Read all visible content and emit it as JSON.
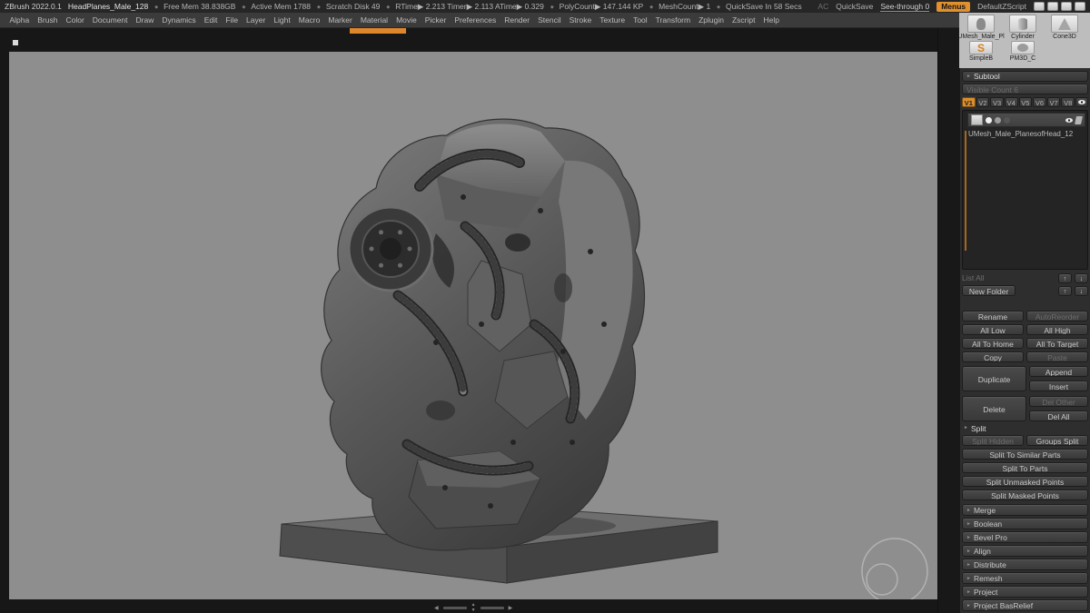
{
  "titlebar": {
    "app_name": "ZBrush 2022.0.1",
    "doc_name": "HeadPlanes_Male_128",
    "stats": [
      "Free Mem 38.838GB",
      "Active Mem 1788",
      "Scratch Disk 49",
      "RTime▶ 2.213 Timer▶ 2.113 ATime▶ 0.329",
      "PolyCount▶ 147.144 KP",
      "MeshCount▶ 1",
      "QuickSave In 58 Secs"
    ],
    "ac": "AC",
    "quicksave": "QuickSave",
    "see_through": "See-through 0",
    "menus": "Menus",
    "default_zscript": "DefaultZScript"
  },
  "menubar": {
    "items": [
      "Alpha",
      "Brush",
      "Color",
      "Document",
      "Draw",
      "Dynamics",
      "Edit",
      "File",
      "Layer",
      "Light",
      "Macro",
      "Marker",
      "Material",
      "Movie",
      "Picker",
      "Preferences",
      "Render",
      "Stencil",
      "Stroke",
      "Texture",
      "Tool",
      "Transform",
      "Zplugin",
      "Zscript",
      "Help"
    ]
  },
  "toolshelf": {
    "items": [
      {
        "label": "UMesh_Male_Pl"
      },
      {
        "label": "Cylinder"
      },
      {
        "label": "Cone3D"
      },
      {
        "label": "SimpleB"
      },
      {
        "label": "PM3D_C"
      }
    ]
  },
  "subtool": {
    "header": "Subtool",
    "visible_count": "Visible Count 6",
    "tabs": [
      "V1",
      "V2",
      "V3",
      "V4",
      "V5",
      "V6",
      "V7",
      "V8"
    ],
    "item_label": "UMesh_Male_PlanesofHead_12",
    "list_all": "List All",
    "new_folder": "New Folder",
    "rename": "Rename",
    "auto_reorder": "AutoReorder",
    "all_low": "All Low",
    "all_high": "All High",
    "all_to_home": "All To Home",
    "all_to_target": "All To Target",
    "copy": "Copy",
    "paste": "Paste",
    "duplicate": "Duplicate",
    "append": "Append",
    "insert": "Insert",
    "delete": "Delete",
    "del_other": "Del Other",
    "del_all": "Del All",
    "split_section": "Split",
    "split_hidden": "Split Hidden",
    "groups_split": "Groups Split",
    "split_similar": "Split To Similar Parts",
    "split_parts": "Split To Parts",
    "split_unmasked": "Split Unmasked Points",
    "split_masked": "Split Masked Points",
    "merge": "Merge",
    "boolean": "Boolean",
    "bevel_pro": "Bevel Pro",
    "align": "Align",
    "distribute": "Distribute",
    "remesh": "Remesh",
    "project": "Project",
    "project_basrelief": "Project BasRelief"
  },
  "icons": {
    "section_arrow": "►",
    "up": "↑",
    "down": "↓",
    "left": "◀",
    "right": "▶",
    "small_up": "▲",
    "small_down": "▼",
    "simpleb_glyph": "S"
  },
  "colors": {
    "accent_orange": "#dd862c",
    "canvas_gray": "#8e8e8e",
    "panel_dark": "#2e2e2e"
  }
}
